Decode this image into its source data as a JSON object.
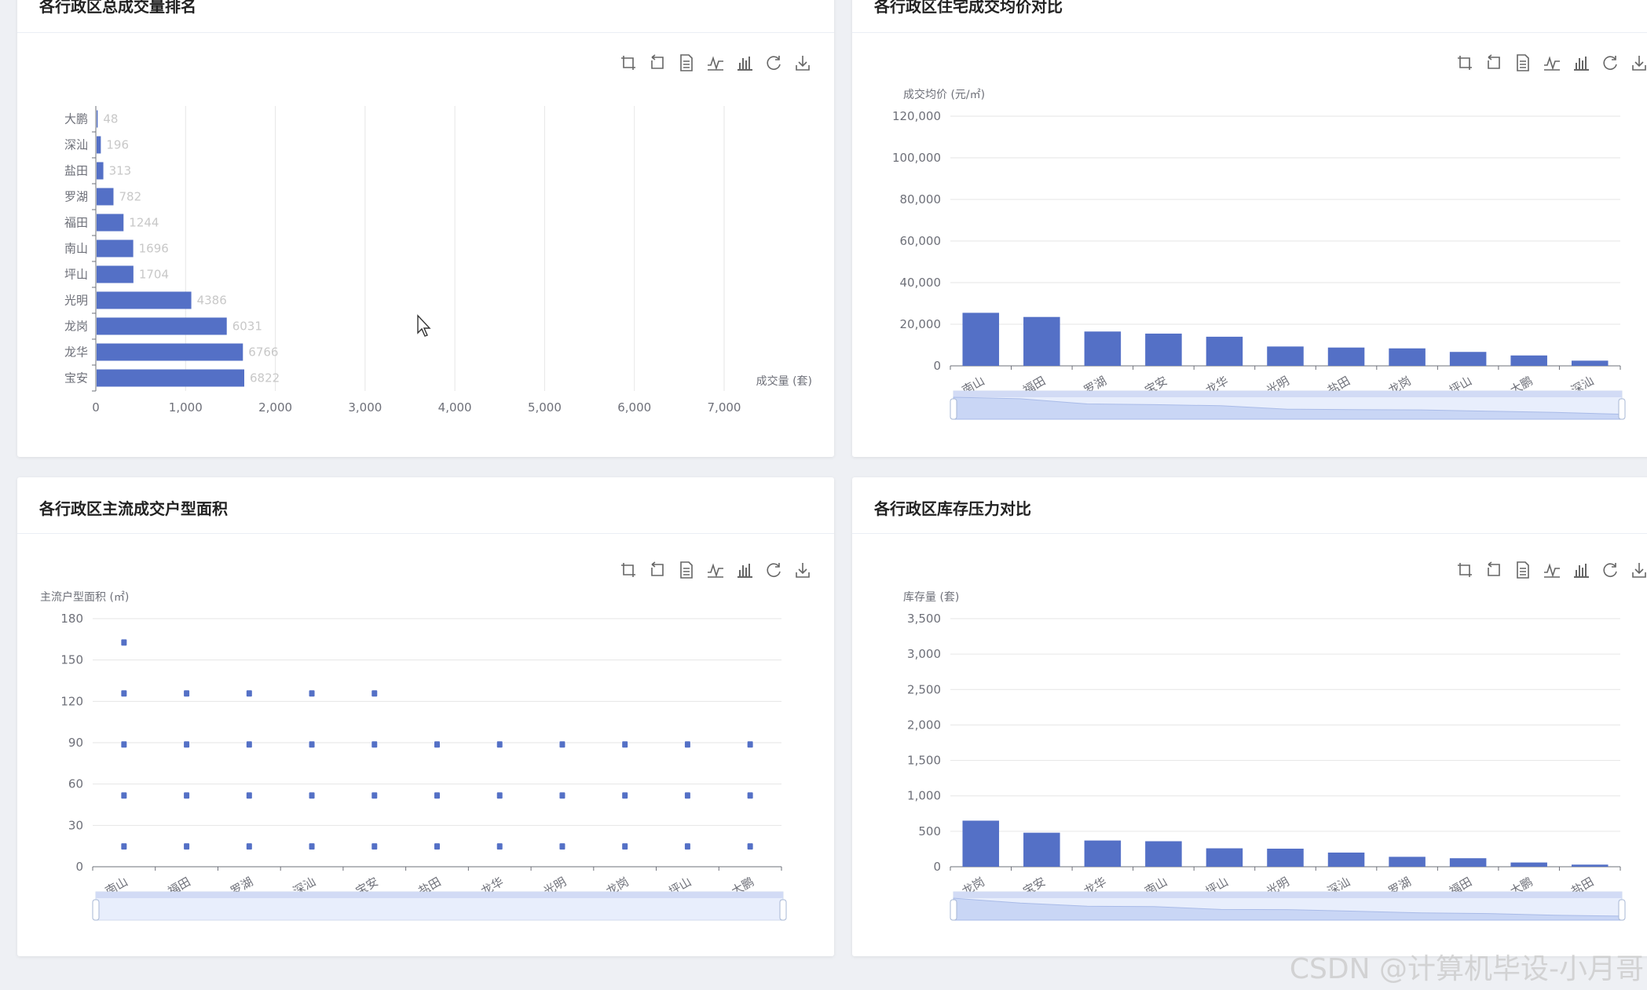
{
  "panels": [
    {
      "title": "各行政区总成交量排名"
    },
    {
      "title": "各行政区住宅成交均价对比"
    },
    {
      "title": "各行政区主流成交户型面积"
    },
    {
      "title": "各行政区库存压力对比"
    }
  ],
  "toolbox": [
    "rect-zoom-icon",
    "zoom-reset-icon",
    "data-view-icon",
    "line-chart-icon",
    "bar-chart-icon",
    "restore-icon",
    "save-image-icon"
  ],
  "accent_color": "#5470c6",
  "watermark": "CSDN @计算机毕设-小月哥",
  "chart_data": [
    {
      "type": "bar",
      "orientation": "horizontal",
      "categories": [
        "宝安",
        "龙华",
        "龙岗",
        "光明",
        "坪山",
        "南山",
        "福田",
        "罗湖",
        "盐田",
        "深汕",
        "大鹏"
      ],
      "values": [
        1645,
        1630,
        1450,
        1055,
        410,
        408,
        300,
        188,
        75,
        47,
        12
      ],
      "data_labels": [
        "6822",
        "6766",
        "6031",
        "4386",
        "1704",
        "1696",
        "1244",
        "782",
        "313",
        "196",
        "48"
      ],
      "xlabel": "成交量 (套)",
      "xlim": [
        0,
        7000
      ],
      "x_ticks": [
        "0",
        "1,000",
        "2,000",
        "3,000",
        "4,000",
        "5,000",
        "6,000",
        "7,000"
      ],
      "grid": "vertical"
    },
    {
      "type": "bar",
      "categories": [
        "南山",
        "福田",
        "罗湖",
        "宝安",
        "龙华",
        "光明",
        "盐田",
        "龙岗",
        "坪山",
        "大鹏",
        "深汕"
      ],
      "values": [
        25500,
        23500,
        16500,
        15500,
        14000,
        9300,
        8800,
        8400,
        6700,
        5000,
        2500
      ],
      "ylabel": "成交均价 (元/㎡)",
      "ylim": [
        0,
        120000
      ],
      "y_ticks": [
        "0",
        "20,000",
        "40,000",
        "60,000",
        "80,000",
        "100,000",
        "120,000"
      ],
      "grid": "horizontal",
      "datazoom": true
    },
    {
      "type": "scatter",
      "categories": [
        "南山",
        "福田",
        "罗湖",
        "深汕",
        "宝安",
        "盐田",
        "龙华",
        "光明",
        "龙岗",
        "坪山",
        "大鹏"
      ],
      "series": [
        {
          "values": [
            15,
            15,
            15,
            15,
            15,
            15,
            15,
            15,
            15,
            15,
            15
          ]
        },
        {
          "values": [
            52,
            52,
            52,
            52,
            52,
            52,
            52,
            52,
            52,
            52,
            52
          ]
        },
        {
          "values": [
            89,
            89,
            89,
            89,
            89,
            89,
            89,
            89,
            89,
            89,
            89
          ]
        },
        {
          "values": [
            126,
            126,
            126,
            126,
            126,
            null,
            null,
            null,
            null,
            null,
            null
          ]
        },
        {
          "values": [
            163,
            null,
            null,
            null,
            null,
            null,
            null,
            null,
            null,
            null,
            null
          ]
        }
      ],
      "ylabel": "主流户型面积 (㎡)",
      "ylim": [
        0,
        180
      ],
      "y_ticks": [
        "0",
        "30",
        "60",
        "90",
        "120",
        "150",
        "180"
      ],
      "grid": "horizontal",
      "datazoom": true
    },
    {
      "type": "bar",
      "categories": [
        "龙岗",
        "宝安",
        "龙华",
        "南山",
        "坪山",
        "光明",
        "深汕",
        "罗湖",
        "福田",
        "大鹏",
        "盐田"
      ],
      "values": [
        650,
        480,
        370,
        360,
        260,
        255,
        200,
        140,
        120,
        60,
        30
      ],
      "ylabel": "库存量 (套)",
      "ylim": [
        0,
        3500
      ],
      "y_ticks": [
        "0",
        "500",
        "1,000",
        "1,500",
        "2,000",
        "2,500",
        "3,000",
        "3,500"
      ],
      "grid": "horizontal",
      "datazoom": true
    }
  ]
}
